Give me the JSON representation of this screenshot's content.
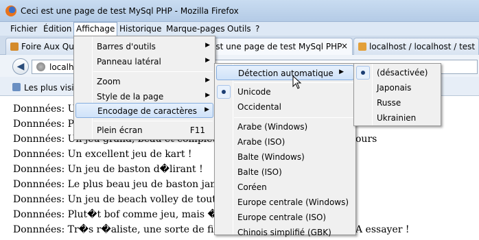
{
  "window": {
    "title": "Ceci est une page de test MySql PHP - Mozilla Firefox"
  },
  "menubar": [
    {
      "label": "Fichier"
    },
    {
      "label": "Édition"
    },
    {
      "label": "Affichage"
    },
    {
      "label": "Historique"
    },
    {
      "label": "Marque-pages"
    },
    {
      "label": "Outils"
    },
    {
      "label": "?"
    }
  ],
  "tabs": [
    {
      "label": "Foire Aux Qu"
    },
    {
      "label": "est une page de test MySql PHP"
    },
    {
      "label": "localhost / localhost / test | ph"
    }
  ],
  "tabs_close": "×",
  "navbar": {
    "url": "localho"
  },
  "bookmarks": {
    "label": "Les plus visit"
  },
  "content_lines": [
    "Donnnées: Un",
    "Donnnées: Po",
    "Donnnées: Un jeu grand, beau et complet con",
    "Donnnées: Un excellent jeu de kart !",
    "Donnnées: Un jeu de baston d�lirant !",
    "Donnnées: Le plus beau jeu de baston jamais",
    "Donnnées: Un jeu de beach volley de toute be",
    "Donnnées: Plut�t bof comme jeu, mais �a c",
    "Donnnées: Tr�s r�aliste, une sorte de film r"
  ],
  "content_extra": {
    "line3_tail": "ours",
    "line9_tail": "A essayer !"
  },
  "menu_affichage": {
    "items": [
      {
        "label": "Barres d'outils",
        "arrow": "▶"
      },
      {
        "label": "Panneau latéral",
        "arrow": "▶"
      },
      {
        "label": "Zoom",
        "arrow": "▶"
      },
      {
        "label": "Style de la page",
        "arrow": "▶"
      },
      {
        "label": "Encodage de caractères",
        "arrow": "▶"
      },
      {
        "label": "Plein écran",
        "shortcut": "F11"
      }
    ]
  },
  "menu_encodage": {
    "items": [
      {
        "label": "Détection automatique",
        "arrow": "▶"
      },
      {
        "label": "Unicode",
        "checked": true
      },
      {
        "label": "Occidental"
      },
      {
        "label": "Arabe (Windows)"
      },
      {
        "label": "Arabe (ISO)"
      },
      {
        "label": "Balte (Windows)"
      },
      {
        "label": "Balte (ISO)"
      },
      {
        "label": "Coréen"
      },
      {
        "label": "Europe centrale (Windows)"
      },
      {
        "label": "Europe centrale (ISO)"
      },
      {
        "label": "Chinois simplifié (GBK)"
      }
    ]
  },
  "menu_detection": {
    "items": [
      {
        "label": "(désactivée)",
        "checked": true
      },
      {
        "label": "Japonais"
      },
      {
        "label": "Russe"
      },
      {
        "label": "Ukrainien"
      }
    ]
  },
  "colors": {
    "menu_highlight": "#cfe2f9",
    "menu_bg": "#f0f0f0",
    "titlebar": "#c9dcf1"
  }
}
